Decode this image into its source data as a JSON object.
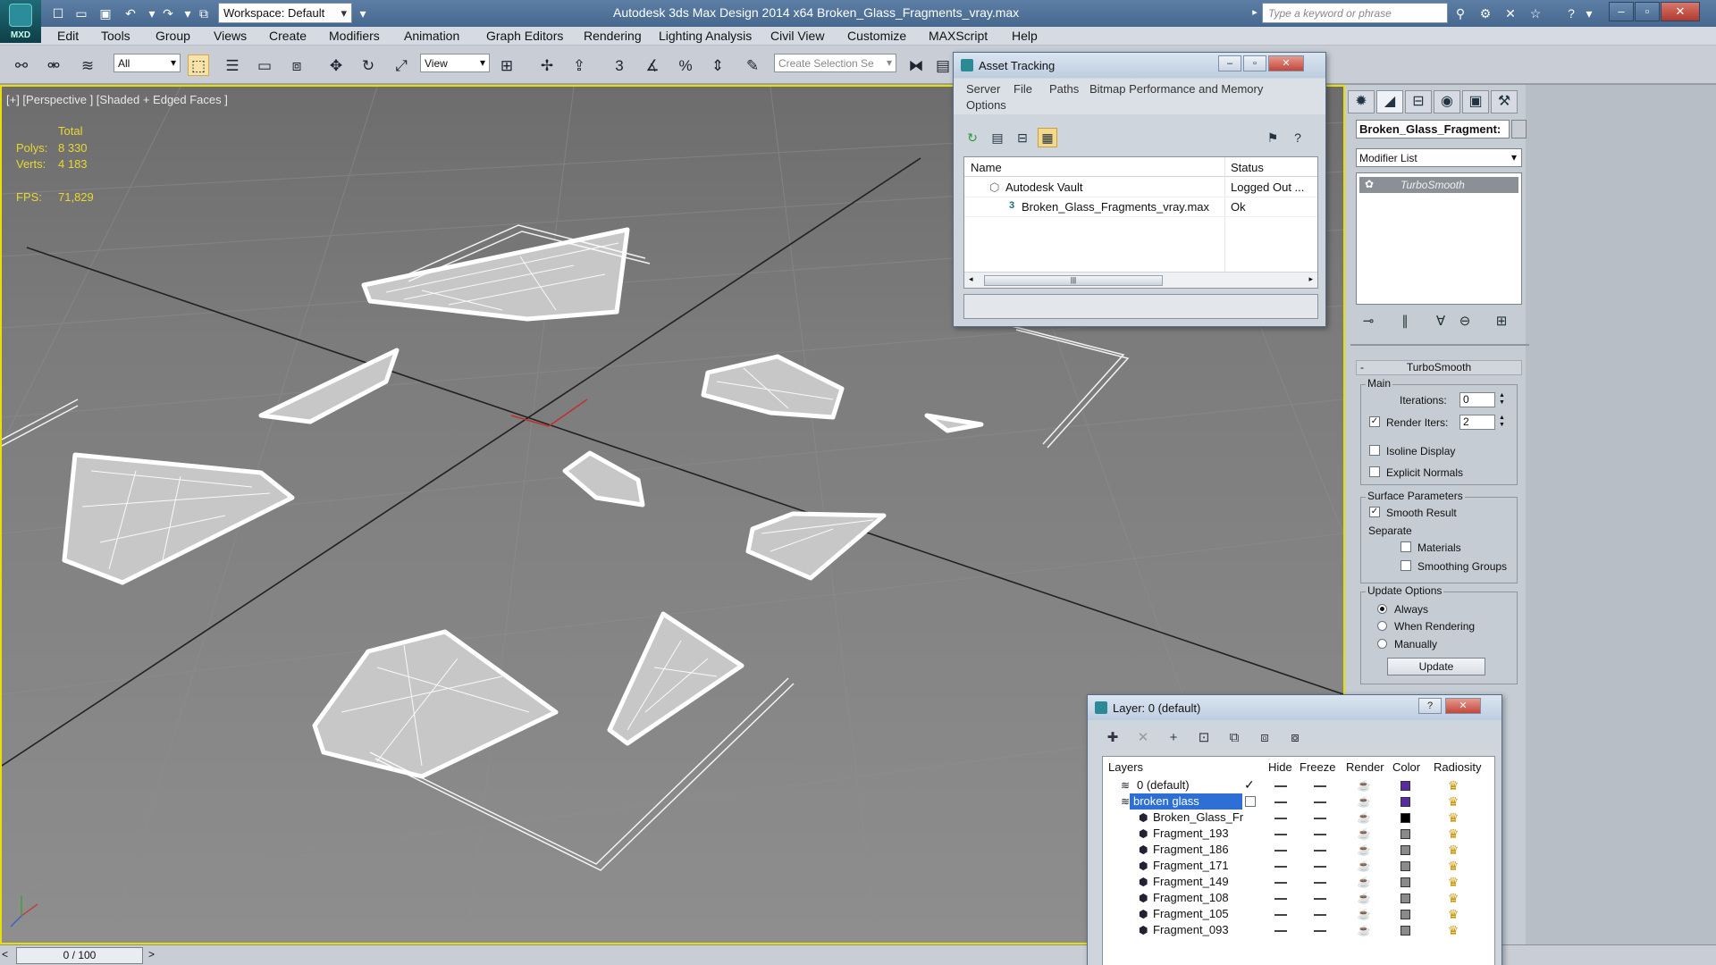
{
  "title_bar": {
    "app_logo": "MXD",
    "workspace": "Workspace: Default",
    "title": "Autodesk 3ds Max Design 2014 x64     Broken_Glass_Fragments_vray.max",
    "search_placeholder": "Type a keyword or phrase"
  },
  "menu": [
    "Edit",
    "Tools",
    "Group",
    "Views",
    "Create",
    "Modifiers",
    "Animation",
    "Graph Editors",
    "Rendering",
    "Lighting Analysis",
    "Civil View",
    "Customize",
    "MAXScript",
    "Help"
  ],
  "toolbar": {
    "filter": "All",
    "ref_coord": "View",
    "selection_set_placeholder": "Create Selection Se",
    "snap_label": "3"
  },
  "viewport": {
    "label": "[+] [Perspective ] [Shaded + Edged Faces ]",
    "stats": {
      "header": "Total",
      "polys_label": "Polys:",
      "polys_value": "8 330",
      "verts_label": "Verts:",
      "verts_value": "4 183",
      "fps_label": "FPS:",
      "fps_value": "71,829"
    }
  },
  "timeline": {
    "frame": "0 / 100",
    "prev": "<",
    "next": ">"
  },
  "command_panel": {
    "object_name": "Broken_Glass_Fragment:",
    "modifier_list": "Modifier List",
    "stack": [
      "TurboSmooth"
    ],
    "rollout": "TurboSmooth",
    "main": {
      "title": "Main",
      "iterations_label": "Iterations:",
      "iterations_value": "0",
      "render_iters_label": "Render Iters:",
      "render_iters_value": "2",
      "render_iters_checked": true,
      "isoline_label": "Isoline Display",
      "isoline_checked": false,
      "explicit_normals_label": "Explicit Normals",
      "explicit_normals_checked": false
    },
    "surface": {
      "title": "Surface Parameters",
      "smooth_result_label": "Smooth Result",
      "smooth_result_checked": true,
      "separate_label": "Separate",
      "materials_label": "Materials",
      "smoothing_groups_label": "Smoothing Groups"
    },
    "update_options": {
      "title": "Update Options",
      "options": [
        "Always",
        "When Rendering",
        "Manually"
      ],
      "selected": "Always",
      "update_button": "Update"
    }
  },
  "asset_tracking": {
    "title": "Asset Tracking",
    "menu": [
      "Server",
      "File",
      "Paths",
      "Bitmap Performance and Memory",
      "Options"
    ],
    "columns": [
      "Name",
      "Status"
    ],
    "rows": [
      {
        "name": "Autodesk Vault",
        "status": "Logged Out ..."
      },
      {
        "name": "Broken_Glass_Fragments_vray.max",
        "status": "Ok",
        "badge": "3"
      }
    ],
    "scroll_grip": "|||"
  },
  "layer_dialog": {
    "title": "Layer: 0 (default)",
    "columns": [
      "Layers",
      "Hide",
      "Freeze",
      "Render",
      "Color",
      "Radiosity"
    ],
    "rows": [
      {
        "name": "0 (default)",
        "color": "#5a2aa0",
        "current": true
      },
      {
        "name": "broken glass",
        "color": "#5a2aa0",
        "selected": true
      },
      {
        "name": "Broken_Glass_Fr",
        "color": "#000000"
      },
      {
        "name": "Fragment_193",
        "color": "#8a8a8a"
      },
      {
        "name": "Fragment_186",
        "color": "#8a8a8a"
      },
      {
        "name": "Fragment_171",
        "color": "#8a8a8a"
      },
      {
        "name": "Fragment_149",
        "color": "#8a8a8a"
      },
      {
        "name": "Fragment_108",
        "color": "#8a8a8a"
      },
      {
        "name": "Fragment_105",
        "color": "#8a8a8a"
      },
      {
        "name": "Fragment_093",
        "color": "#8a8a8a"
      }
    ]
  },
  "colors": {
    "titlebar": "#4f7199",
    "viewport_border": "#e8e000",
    "stats_text": "#e8d830",
    "selection": "#2e6fd6"
  }
}
